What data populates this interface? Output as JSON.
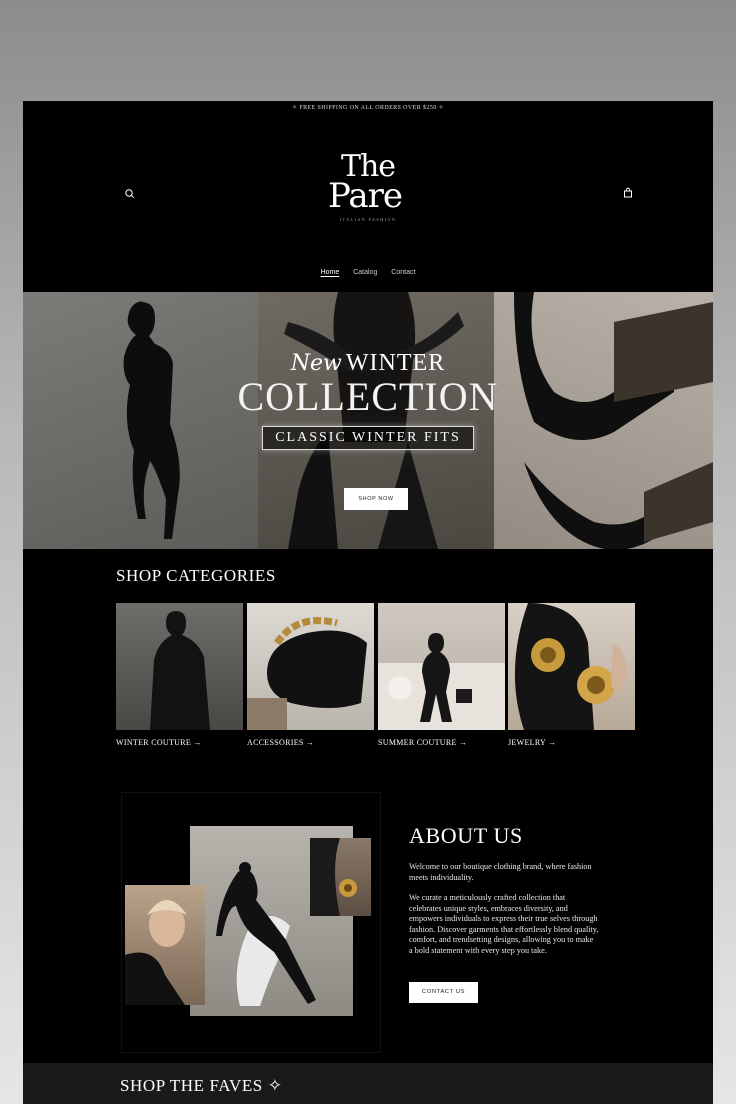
{
  "announcement": "✧ FREE SHIPPING ON ALL ORDERS OVER $250 ✧",
  "brand": {
    "line1": "The",
    "line2": "Pare",
    "tagline": "ITALIAN FASHION"
  },
  "icons": {
    "search": "search-icon",
    "cart": "shopping-bag-icon"
  },
  "nav": {
    "items": [
      {
        "label": "Home",
        "active": true
      },
      {
        "label": "Catalog",
        "active": false
      },
      {
        "label": "Contact",
        "active": false
      }
    ]
  },
  "hero": {
    "script": "New",
    "winter": "WINTER",
    "collection": "COLLECTION",
    "subtitle": "CLASSIC WINTER FITS",
    "cta": "SHOP NOW"
  },
  "categories": {
    "title": "SHOP CATEGORIES",
    "items": [
      {
        "label": "WINTER COUTURE →"
      },
      {
        "label": "ACCESSORIES →"
      },
      {
        "label": "SUMMER COUTURE →"
      },
      {
        "label": "JEWELRY →"
      }
    ]
  },
  "about": {
    "title": "ABOUT US",
    "p1": "Welcome to our boutique clothing brand, where fashion meets individuality.",
    "p2": "We curate a meticulously crafted collection that celebrates unique styles, embraces diversity, and empowers individuals to express their true selves through fashion. Discover garments that effortlessly blend quality, comfort, and trendsetting designs, allowing you to make a bold statement with every step you take.",
    "cta": "CONTACT US"
  },
  "faves": {
    "title": "SHOP THE FAVES ✧"
  },
  "colors": {
    "background": "#000000",
    "text": "#ffffff",
    "button": "#ffffff"
  }
}
